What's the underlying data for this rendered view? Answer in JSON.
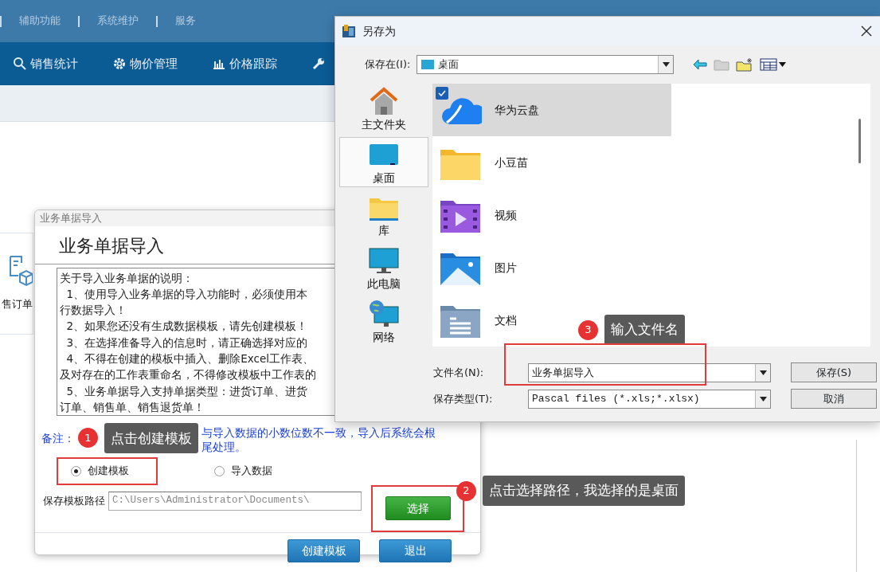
{
  "app": {
    "top_menu": [
      "辅助功能",
      "系统维护",
      "服务"
    ],
    "nav": [
      "销售统计",
      "物价管理",
      "价格跟踪"
    ],
    "tile_label": "售订单"
  },
  "import_dialog": {
    "title": "业务单据导入",
    "heading": "业务单据导入",
    "instructions": [
      "关于导入业务单据的说明：",
      "  1、使用导入业务单据的导入功能时，必须使用本",
      "行数据导入！",
      "  2、如果您还没有生成数据模板，请先创建模板！",
      "  3、在选择准备导入的信息时，请正确选择对应的",
      "  4、不得在创建的模板中插入、删除Excel工作表、",
      "及对存在的工作表重命名，不得修改模板中工作表的",
      "  5、业务单据导入支持单据类型：进货订单、进货",
      "订单、销售单、销售退货单！"
    ],
    "note": {
      "label": "备注：",
      "lines": [
        "与导入数据的小数位数不一致，导入后系统会根",
        "尾处理。"
      ]
    },
    "options": [
      {
        "label": "创建模板",
        "selected": true
      },
      {
        "label": "导入数据",
        "selected": false
      }
    ],
    "path_label": "保存模板路径",
    "path_value": "C:\\Users\\Administrator\\Documents\\",
    "choose_button": "选择",
    "buttons": [
      "创建模板",
      "退出"
    ]
  },
  "save_dialog": {
    "title": "另存为",
    "location_label": "保存在(I):",
    "location": "桌面",
    "places": [
      {
        "label": "主文件夹",
        "selected": false
      },
      {
        "label": "桌面",
        "selected": true
      },
      {
        "label": "库",
        "selected": false
      },
      {
        "label": "此电脑",
        "selected": false
      },
      {
        "label": "网络",
        "selected": false
      }
    ],
    "files": [
      {
        "name": "华为云盘",
        "selected": true
      },
      {
        "name": "小豆苗",
        "selected": false
      },
      {
        "name": "视频",
        "selected": false
      },
      {
        "name": "图片",
        "selected": false
      },
      {
        "name": "文档",
        "selected": false
      }
    ],
    "filename_label": "文件名(N):",
    "filename": "业务单据导入",
    "filetype_label": "保存类型(T):",
    "filetype": "Pascal files (*.xls;*.xlsx)",
    "buttons": [
      "保存(S)",
      "取消"
    ]
  },
  "callouts": [
    {
      "number": "1",
      "text": "点击创建模板"
    },
    {
      "number": "3",
      "text": "输入文件名"
    },
    {
      "number": "2",
      "text": "点击选择路径，我选择的是桌面"
    }
  ]
}
